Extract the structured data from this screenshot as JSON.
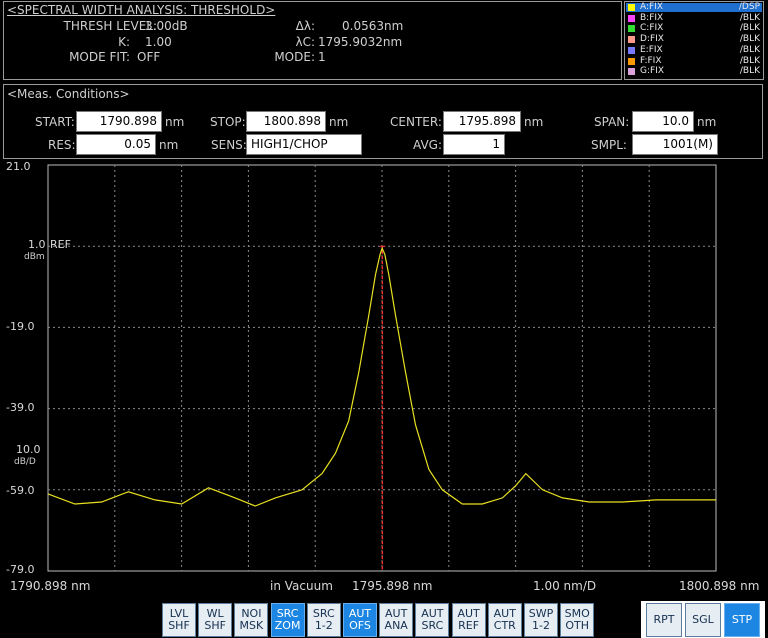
{
  "analysis": {
    "title": "<SPECTRAL WIDTH ANALYSIS: THRESHOLD>",
    "thresh_label": "THRESH LEVEL:",
    "thresh_value": "3.00dB",
    "k_label": "K:",
    "k_value": "1.00",
    "modefit_label": "MODE FIT:",
    "modefit_value": "OFF",
    "dl_label": "Δλ:",
    "dl_value": "0.0563nm",
    "lc_label": "λC:",
    "lc_value": "1795.9032nm",
    "mode_label": "MODE:",
    "mode_value": "1"
  },
  "traces": [
    {
      "name": "A:FIX",
      "status": "/DSP",
      "color": "#ffff00",
      "selected": true
    },
    {
      "name": "B:FIX",
      "status": "/BLK",
      "color": "#ff44ff",
      "selected": false
    },
    {
      "name": "C:FIX",
      "status": "/BLK",
      "color": "#33dd33",
      "selected": false
    },
    {
      "name": "D:FIX",
      "status": "/BLK",
      "color": "#ff9a8a",
      "selected": false
    },
    {
      "name": "E:FIX",
      "status": "/BLK",
      "color": "#7777ff",
      "selected": false
    },
    {
      "name": "F:FIX",
      "status": "/BLK",
      "color": "#ff9900",
      "selected": false
    },
    {
      "name": "G:FIX",
      "status": "/BLK",
      "color": "#d9a0d9",
      "selected": false
    }
  ],
  "meas": {
    "title": "<Meas. Conditions>",
    "start_label": "START:",
    "start_value": "1790.898",
    "start_unit": "nm",
    "stop_label": "STOP:",
    "stop_value": "1800.898",
    "stop_unit": "nm",
    "center_label": "CENTER:",
    "center_value": "1795.898",
    "center_unit": "nm",
    "span_label": "SPAN:",
    "span_value": "10.0",
    "span_unit": "nm",
    "res_label": "RES:",
    "res_value": "0.05",
    "res_unit": "nm",
    "sens_label": "SENS:",
    "sens_value": "HIGH1/CHOP",
    "avg_label": "AVG:",
    "avg_value": "1",
    "smpl_label": "SMPL:",
    "smpl_value": "1001(M)"
  },
  "chart_data": {
    "type": "line",
    "y_ticks": [
      "21.0",
      "1.0",
      "-19.0",
      "-39.0",
      "-59.0",
      "-79.0"
    ],
    "y_ticks_values": [
      21.0,
      1.0,
      -19.0,
      -39.0,
      -59.0,
      -79.0
    ],
    "ref_label": "REF",
    "ref_unit": "dBm",
    "scale_value": "10.0",
    "scale_unit": "dB/D",
    "ylim": [
      -79.0,
      21.0
    ],
    "xlim": [
      1790.898,
      1800.898
    ],
    "x_start_label": "1790.898",
    "x_center_label": "1795.898",
    "x_stop_label": "1800.898",
    "x_unit": "nm",
    "x_div_label": "1.00",
    "x_div_unit": "nm/D",
    "medium_label": "in Vacuum",
    "marker_x": 1795.903,
    "series": [
      {
        "color": "#e8e020",
        "x": [
          1790.898,
          1791.3,
          1791.7,
          1792.1,
          1792.5,
          1792.9,
          1793.3,
          1793.7,
          1794.0,
          1794.3,
          1794.7,
          1795.0,
          1795.2,
          1795.4,
          1795.55,
          1795.7,
          1795.8,
          1795.87,
          1795.9,
          1795.94,
          1796.0,
          1796.1,
          1796.25,
          1796.4,
          1796.6,
          1796.8,
          1797.1,
          1797.4,
          1797.7,
          1797.9,
          1798.05,
          1798.3,
          1798.6,
          1799.0,
          1799.5,
          1800.0,
          1800.5,
          1800.898
        ],
        "values": [
          -60.0,
          -62.5,
          -62.0,
          -59.5,
          -61.5,
          -62.5,
          -58.5,
          -61.0,
          -63.0,
          -61.0,
          -59.0,
          -55.0,
          -50.0,
          -42.0,
          -30.0,
          -16.0,
          -6.0,
          -1.0,
          0.5,
          -1.0,
          -6.0,
          -16.0,
          -30.0,
          -43.0,
          -54.0,
          -59.0,
          -62.5,
          -62.5,
          -61.0,
          -58.0,
          -55.0,
          -59.0,
          -61.0,
          -62.0,
          -62.0,
          -61.5,
          -61.5,
          -61.5
        ]
      }
    ]
  },
  "buttons": [
    {
      "label": "LVL\nSHF",
      "active": false
    },
    {
      "label": "WL\nSHF",
      "active": false
    },
    {
      "label": "NOI\nMSK",
      "active": false
    },
    {
      "label": "SRC\nZOM",
      "active": true
    },
    {
      "label": "SRC\n1-2",
      "active": false
    },
    {
      "label": "AUT\nOFS",
      "active": true
    },
    {
      "label": "AUT\nANA",
      "active": false
    },
    {
      "label": "AUT\nSRC",
      "active": false
    },
    {
      "label": "AUT\nREF",
      "active": false
    },
    {
      "label": "AUT\nCTR",
      "active": false
    },
    {
      "label": "SWP\n1-2",
      "active": false
    },
    {
      "label": "SMO\nOTH",
      "active": false
    }
  ],
  "sweep_buttons": [
    {
      "label": "RPT",
      "active": false
    },
    {
      "label": "SGL",
      "active": false
    },
    {
      "label": "STP",
      "active": true
    }
  ]
}
